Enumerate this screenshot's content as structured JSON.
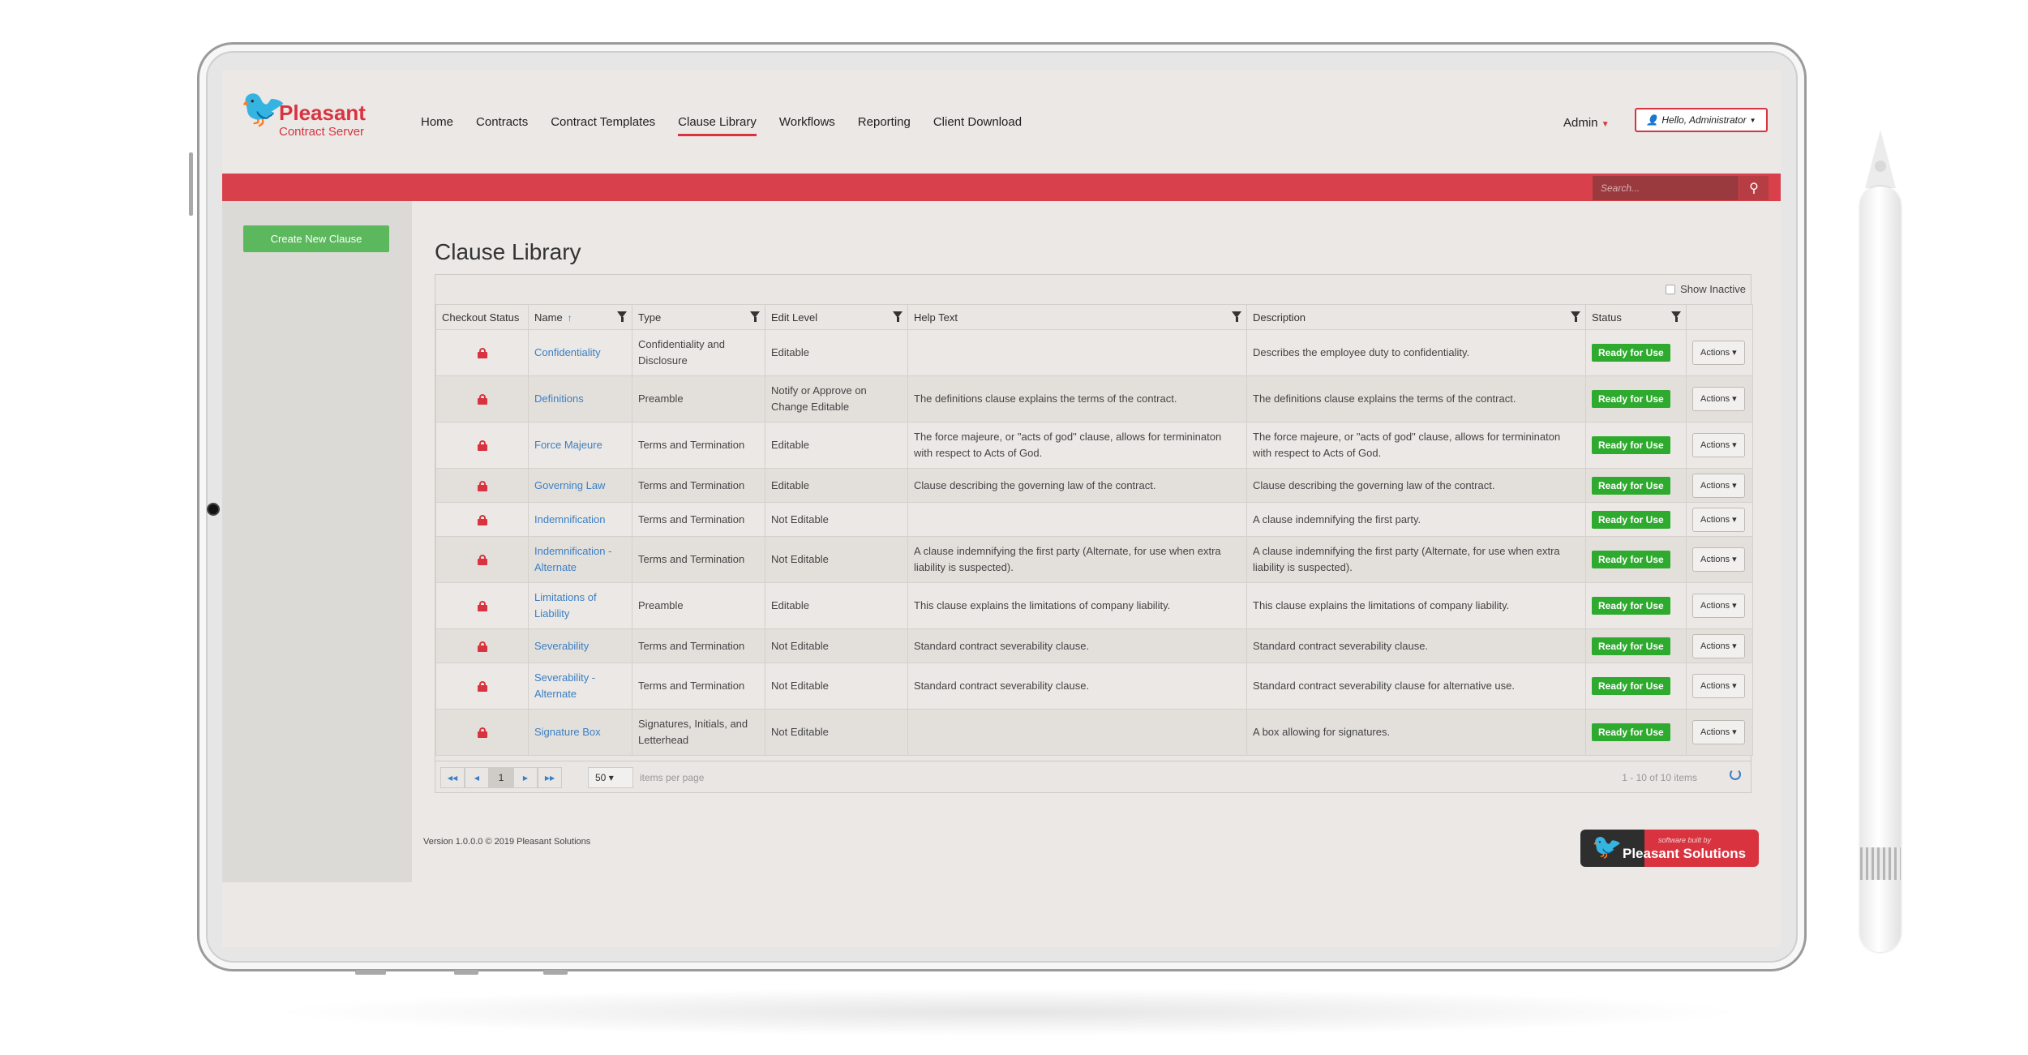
{
  "header": {
    "logo_title": "Pleasant",
    "logo_subtitle": "Contract Server",
    "nav": [
      "Home",
      "Contracts",
      "Contract Templates",
      "Clause Library",
      "Workflows",
      "Reporting",
      "Client Download"
    ],
    "active_nav": "Clause Library",
    "admin_label": "Admin",
    "user_label": "Hello, Administrator",
    "search_placeholder": "Search..."
  },
  "sidebar": {
    "create_button": "Create New Clause"
  },
  "main": {
    "title": "Clause Library",
    "show_inactive": "Show Inactive",
    "columns": [
      "Checkout Status",
      "Name",
      "Type",
      "Edit Level",
      "Help Text",
      "Description",
      "Status",
      ""
    ],
    "rows": [
      {
        "name": "Confidentiality",
        "type": "Confidentiality and Disclosure",
        "edit": "Editable",
        "help": "",
        "desc": "Describes the employee duty to confidentiality.",
        "status": "Ready for Use",
        "actions": "Actions"
      },
      {
        "name": "Definitions",
        "type": "Preamble",
        "edit": "Notify or Approve on Change Editable",
        "help": "The definitions clause explains the terms of the contract.",
        "desc": "The definitions clause explains the terms of the contract.",
        "status": "Ready for Use",
        "actions": "Actions"
      },
      {
        "name": "Force Majeure",
        "type": "Terms and Termination",
        "edit": "Editable",
        "help": "The force majeure, or \"acts of god\" clause, allows for termininaton with respect to Acts of God.",
        "desc": "The force majeure, or \"acts of god\" clause, allows for termininaton with respect to Acts of God.",
        "status": "Ready for Use",
        "actions": "Actions"
      },
      {
        "name": "Governing Law",
        "type": "Terms and Termination",
        "edit": "Editable",
        "help": "Clause describing the governing law of the contract.",
        "desc": "Clause describing the governing law of the contract.",
        "status": "Ready for Use",
        "actions": "Actions"
      },
      {
        "name": "Indemnification",
        "type": "Terms and Termination",
        "edit": "Not Editable",
        "help": "",
        "desc": "A clause indemnifying the first party.",
        "status": "Ready for Use",
        "actions": "Actions"
      },
      {
        "name": "Indemnification - Alternate",
        "type": "Terms and Termination",
        "edit": "Not Editable",
        "help": "A clause indemnifying the first party (Alternate, for use when extra liability is suspected).",
        "desc": "A clause indemnifying the first party (Alternate, for use when extra liability is suspected).",
        "status": "Ready for Use",
        "actions": "Actions"
      },
      {
        "name": "Limitations of Liability",
        "type": "Preamble",
        "edit": "Editable",
        "help": "This clause explains the limitations of company liability.",
        "desc": "This clause explains the limitations of company liability.",
        "status": "Ready for Use",
        "actions": "Actions"
      },
      {
        "name": "Severability",
        "type": "Terms and Termination",
        "edit": "Not Editable",
        "help": "Standard contract severability clause.",
        "desc": "Standard contract severability clause.",
        "status": "Ready for Use",
        "actions": "Actions"
      },
      {
        "name": "Severability - Alternate",
        "type": "Terms and Termination",
        "edit": "Not Editable",
        "help": "Standard contract severability clause.",
        "desc": "Standard contract severability clause for alternative use.",
        "status": "Ready for Use",
        "actions": "Actions"
      },
      {
        "name": "Signature Box",
        "type": "Signatures, Initials, and Letterhead",
        "edit": "Not Editable",
        "help": "",
        "desc": "A box allowing for signatures.",
        "status": "Ready for Use",
        "actions": "Actions"
      }
    ],
    "pager": {
      "current_page": "1",
      "per_page": "50",
      "per_page_label": "items per page",
      "range": "1 - 10 of 10 items"
    }
  },
  "footer": {
    "version": "Version 1.0.0.0 © 2019 Pleasant Solutions",
    "badge_small": "software built by",
    "badge_big": "Pleasant Solutions"
  },
  "colors": {
    "brand_red": "#d8333f",
    "status_green": "#2eaa2e",
    "link_blue": "#3b7fc4",
    "create_green": "#5cb85c"
  }
}
